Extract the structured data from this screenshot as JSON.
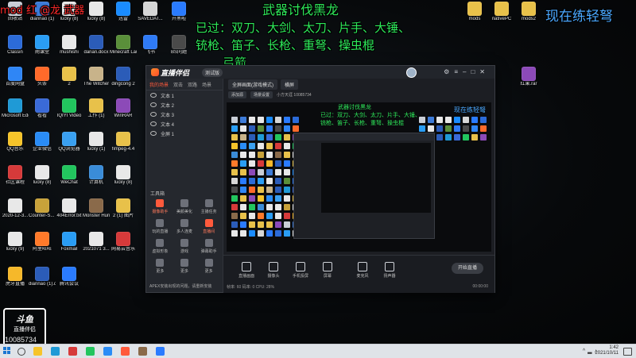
{
  "overlay": {
    "mod_text": "mod   红 @龙 武器",
    "title": "武器讨伐黑龙",
    "line1": "已过：双刀、大剑、太刀、片手、大锤、",
    "line2": "铳枪、笛子、长枪、重弩、操虫棍",
    "line3": "弓箭",
    "right_text": "现在练轻弩",
    "colors": {
      "green": "#2ee85a",
      "red": "#ff2a2a",
      "blue": "#4aa8ff"
    }
  },
  "desktop_icons": [
    {
      "label": "回收站",
      "color": "#c9ced6"
    },
    {
      "label": "diannao (1)",
      "color": "#3d7bd8"
    },
    {
      "label": "lucky (8)",
      "color": "#e8e8e8"
    },
    {
      "label": "lucky (8)",
      "color": "#e8e8e8"
    },
    {
      "label": "迅雷",
      "color": "#1a8cff"
    },
    {
      "label": "SAVEDAT...",
      "color": "#d6d6d6"
    },
    {
      "label": "开黑啦",
      "color": "#2a7bff"
    },
    {
      "label": "Classin",
      "color": "#2c6bd8"
    },
    {
      "label": "雨课堂",
      "color": "#2a9df4"
    },
    {
      "label": "mushishi",
      "color": "#e8e8e8"
    },
    {
      "label": "danan.docx",
      "color": "#2b5cb8"
    },
    {
      "label": "Minecraft Launcher",
      "color": "#5a8f3a"
    },
    {
      "label": "飞书",
      "color": "#2f7bf6"
    },
    {
      "label": "BS问题",
      "color": "#4a4a4a"
    },
    {
      "label": "百度网盘",
      "color": "#2f86f6"
    },
    {
      "label": "头条",
      "color": "#ff6a2a"
    },
    {
      "label": "2",
      "color": "#e8c14a"
    },
    {
      "label": "The Witcher",
      "color": "#c8b38a"
    },
    {
      "label": "dingcong 2",
      "color": "#2b5cb8"
    },
    {
      "label": "Microsoft Edge",
      "color": "#1f9ad6"
    },
    {
      "label": "看看",
      "color": "#3a6ad8"
    },
    {
      "label": "IQIYI Video",
      "color": "#22c55e"
    },
    {
      "label": "工作 (1)",
      "color": "#e8c14a"
    },
    {
      "label": "WinRAR",
      "color": "#8c4ab8"
    },
    {
      "label": "QQ音乐",
      "color": "#f6c42a"
    },
    {
      "label": "企业微信",
      "color": "#2a8cf6"
    },
    {
      "label": "QQ浏览器",
      "color": "#3aa0f0"
    },
    {
      "label": "lucky (1)",
      "color": "#e8e8e8"
    },
    {
      "label": "fimpeg-4.4",
      "color": "#e8c14a"
    },
    {
      "label": "社区课程",
      "color": "#d63a3a"
    },
    {
      "label": "lucky (8)",
      "color": "#e8e8e8"
    },
    {
      "label": "WeChat",
      "color": "#22c55e"
    },
    {
      "label": "计算机",
      "color": "#3a8cd8"
    },
    {
      "label": "lucky (8)",
      "color": "#e8e8e8"
    },
    {
      "label": "2020-12-3...",
      "color": "#e8e8e8"
    },
    {
      "label": "Counter-S... Global Offi...",
      "color": "#c8a23a"
    },
    {
      "label": "404Error.txt",
      "color": "#e8e8e8"
    },
    {
      "label": "Monster Hunter...",
      "color": "#8a6a4a"
    },
    {
      "label": "2 (1) 图片",
      "color": "#e8c14a"
    },
    {
      "label": "lucky (9)",
      "color": "#e8e8e8"
    },
    {
      "label": "阿里旺旺",
      "color": "#ff7a2a"
    },
    {
      "label": "Foxmail",
      "color": "#2a9df4"
    },
    {
      "label": "2021071 3...",
      "color": "#e8e8e8"
    },
    {
      "label": "网易云音乐",
      "color": "#d63a3a"
    },
    {
      "label": "虎牙直播",
      "color": "#f6b82a"
    },
    {
      "label": "diannao (1).docx",
      "color": "#2b5cb8"
    },
    {
      "label": "腾讯会议",
      "color": "#2a7bff"
    },
    {
      "label": "mods",
      "color": "#e8c14a"
    },
    {
      "label": "nativePC",
      "color": "#e8c14a"
    },
    {
      "label": "mods2",
      "color": "#e8c14a"
    },
    {
      "label": "红果.rar",
      "color": "#8c4ab8"
    }
  ],
  "app": {
    "brand": "直播伴侣",
    "version": "测试版",
    "left_tabs": [
      "我的场景",
      "双击",
      "双路",
      "场景"
    ],
    "layers": [
      "文本 1",
      "文本 2",
      "文本 3",
      "文本 4",
      "全屏 1"
    ],
    "tools_header": "工具箱",
    "tools": [
      {
        "label": "摄像助手",
        "active": true
      },
      {
        "label": "美颜美化",
        "active": false
      },
      {
        "label": "主播任务",
        "active": false
      },
      {
        "label": "玩的直播",
        "active": false
      },
      {
        "label": "多人连麦",
        "active": false
      },
      {
        "label": "直播间",
        "active": true
      },
      {
        "label": "虚拟形象",
        "active": false
      },
      {
        "label": "游戏",
        "active": false
      },
      {
        "label": "弹幕助手",
        "active": false
      },
      {
        "label": "更多",
        "active": false
      },
      {
        "label": "更多",
        "active": false
      },
      {
        "label": "更多",
        "active": false
      }
    ],
    "note_text": "APEX安装出现的问题，请重新安装",
    "preview_tabs": [
      "全屏画面(游戏模式)",
      "横屏"
    ],
    "preview_bar": {
      "chip1": "添加源",
      "chip2": "场景设置",
      "info": "小方天涯  10085734"
    },
    "controls": [
      "直播画面",
      "摄像头",
      "手机投屏",
      "屏幕",
      "麦克风",
      "扬声器"
    ],
    "go_live": "开始直播",
    "status_left": "帧率: 60  码率: 0  CPU: 28%",
    "status_right": "00:00:00"
  },
  "watermark": {
    "top": "斗鱼",
    "sub": "直播伴侣",
    "room_id": "10085734"
  },
  "taskbar": {
    "time": "1:42",
    "date": "2021/10/11",
    "apps": [
      {
        "name": "explorer",
        "color": "#f6c42a"
      },
      {
        "name": "edge",
        "color": "#1f9ad6"
      },
      {
        "name": "chrome",
        "color": "#d63a3a"
      },
      {
        "name": "wechat",
        "color": "#22c55e"
      },
      {
        "name": "qq",
        "color": "#2a8cf6"
      },
      {
        "name": "live",
        "color": "#ff5a3c"
      },
      {
        "name": "game",
        "color": "#8a6a4a"
      },
      {
        "name": "store",
        "color": "#2a7bff"
      }
    ]
  }
}
